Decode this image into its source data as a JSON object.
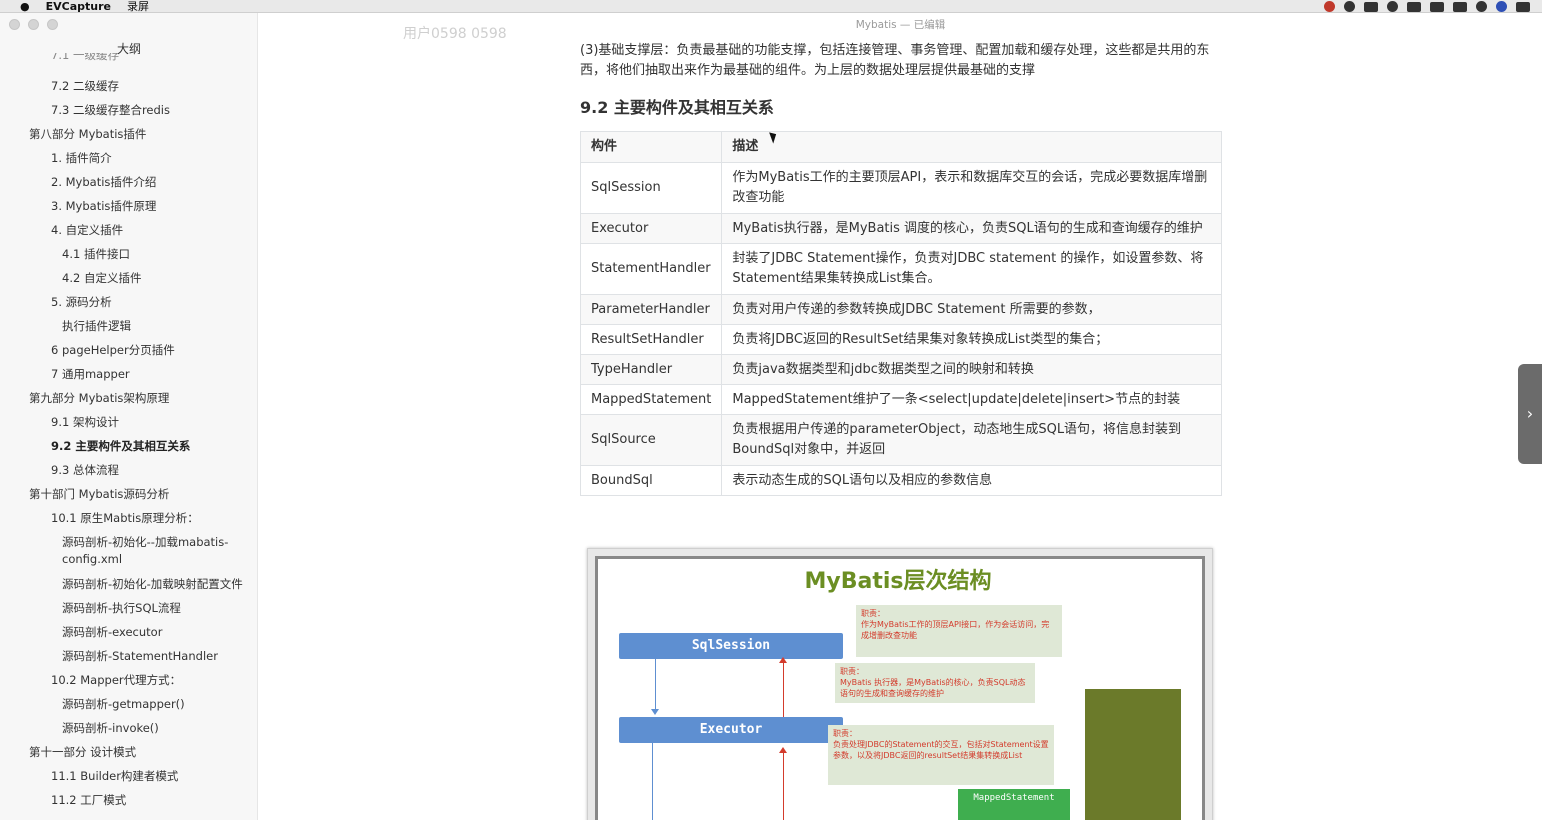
{
  "menubar": {
    "app_name": "EVCapture",
    "menu_record": "录屏"
  },
  "window": {
    "doc_title": "Mybatis — 已编辑",
    "watermark": "用户0598 0598"
  },
  "sidebar": {
    "title": "大纲",
    "items": [
      {
        "label": "7.1 一级缓存"
      },
      {
        "label": "7.2 二级缓存"
      },
      {
        "label": "7.3 二级缓存整合redis"
      },
      {
        "label": "第八部分 Mybatis插件"
      },
      {
        "label": "1. 插件简介"
      },
      {
        "label": "2. Mybatis插件介绍"
      },
      {
        "label": "3. Mybatis插件原理"
      },
      {
        "label": "4. 自定义插件"
      },
      {
        "label": "4.1 插件接口"
      },
      {
        "label": "4.2 自定义插件"
      },
      {
        "label": "5. 源码分析"
      },
      {
        "label": "执行插件逻辑"
      },
      {
        "label": "6 pageHelper分页插件"
      },
      {
        "label": "7 通用mapper"
      },
      {
        "label": "第九部分 Mybatis架构原理"
      },
      {
        "label": "9.1 架构设计"
      },
      {
        "label": "9.2 主要构件及其相互关系"
      },
      {
        "label": "9.3 总体流程"
      },
      {
        "label": "第十部门 Mybatis源码分析"
      },
      {
        "label": "10.1 原生Mabtis原理分析："
      },
      {
        "label": "源码剖析-初始化--加载mabatis-config.xml"
      },
      {
        "label": "源码剖析-初始化-加载映射配置文件"
      },
      {
        "label": "源码剖析-执行SQL流程"
      },
      {
        "label": "源码剖析-executor"
      },
      {
        "label": "源码剖析-StatementHandler"
      },
      {
        "label": "10.2 Mapper代理方式："
      },
      {
        "label": "源码剖析-getmapper()"
      },
      {
        "label": "源码剖析-invoke()"
      },
      {
        "label": "第十一部分 设计模式"
      },
      {
        "label": "11.1 Builder构建者模式"
      },
      {
        "label": "11.2 工厂模式"
      }
    ]
  },
  "content": {
    "paragraph": "(3)基础支撑层：负责最基础的功能支撑，包括连接管理、事务管理、配置加载和缓存处理，这些都是共用的东西，将他们抽取出来作为最基础的组件。为上层的数据处理层提供最基础的支撑",
    "heading": "9.2 主要构件及其相互关系",
    "table": {
      "headers": [
        "构件",
        "描述"
      ],
      "rows": [
        {
          "name": "SqlSession",
          "desc": "作为MyBatis工作的主要顶层API，表示和数据库交互的会话，完成必要数据库增删改查功能"
        },
        {
          "name": "Executor",
          "desc": "MyBatis执行器，是MyBatis 调度的核心，负责SQL语句的生成和查询缓存的维护"
        },
        {
          "name": "StatementHandler",
          "desc": "封装了JDBC Statement操作，负责对JDBC statement 的操作，如设置参数、将Statement结果集转换成List集合。"
        },
        {
          "name": "ParameterHandler",
          "desc": "负责对用户传递的参数转换成JDBC Statement 所需要的参数，"
        },
        {
          "name": "ResultSetHandler",
          "desc": "负责将JDBC返回的ResultSet结果集对象转换成List类型的集合；"
        },
        {
          "name": "TypeHandler",
          "desc": "负责java数据类型和jdbc数据类型之间的映射和转换"
        },
        {
          "name": "MappedStatement",
          "desc": "MappedStatement维护了一条<select|update|delete|insert>节点的封装"
        },
        {
          "name": "SqlSource",
          "desc": "负责根据用户传递的parameterObject，动态地生成SQL语句，将信息封装到BoundSql对象中，并返回"
        },
        {
          "name": "BoundSql",
          "desc": "表示动态生成的SQL语句以及相应的参数信息"
        }
      ]
    },
    "diagram": {
      "title": "MyBatis层次结构",
      "sqlsession": "SqlSession",
      "executor": "Executor",
      "mapped": "MappedStatement",
      "note1": "职责：\n作为MyBatis工作的顶层API接口，作为会话访问，完成增删改查功能",
      "note2": "职责：\nMyBatis 执行器，是MyBatis的核心，负责SQL动态语句的生成和查询缓存的维护",
      "note3": "职责：\n负责处理JDBC的Statement的交互，包括对Statement设置参数，以及将JDBC返回的resultSet结果集转换成List"
    }
  },
  "colors": {
    "layer_blue": "#5e8fd1",
    "note_red": "#d33b2c",
    "title_green": "#6b8e23"
  }
}
